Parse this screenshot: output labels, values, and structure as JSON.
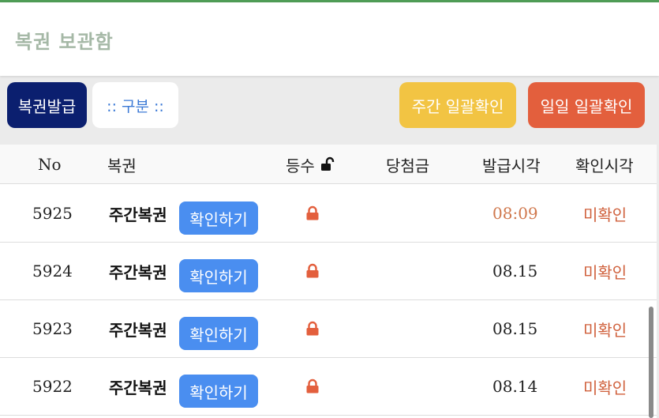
{
  "header": {
    "title": "복권 보관함"
  },
  "toolbar": {
    "issue_label": "복권발급",
    "category_label": ":: 구분 ::",
    "weekly_confirm_label": "주간 일괄확인",
    "daily_confirm_label": "일일 일괄확인"
  },
  "table": {
    "headers": {
      "no": "No",
      "lottery": "복권",
      "round": "등수",
      "prize": "당첨금",
      "issued_time": "발급시각",
      "checked_time": "확인시각"
    },
    "rows": [
      {
        "no": "5925",
        "name": "주간복권",
        "action": "확인하기",
        "issued": "08:09",
        "status": "미확인"
      },
      {
        "no": "5924",
        "name": "주간복권",
        "action": "확인하기",
        "issued": "08.15",
        "status": "미확인"
      },
      {
        "no": "5923",
        "name": "주간복권",
        "action": "확인하기",
        "issued": "08.15",
        "status": "미확인"
      },
      {
        "no": "5922",
        "name": "주간복권",
        "action": "확인하기",
        "issued": "08.14",
        "status": "미확인"
      }
    ]
  },
  "icons": {
    "lock_closed": "lock-icon",
    "lock_open": "unlock-icon"
  },
  "colors": {
    "accent_green": "#4f9d57",
    "issue_button": "#0b1f6f",
    "weekly_button": "#f2c443",
    "daily_button": "#e35f3d",
    "check_button": "#4a8ef0",
    "status_text": "#d0613d"
  }
}
